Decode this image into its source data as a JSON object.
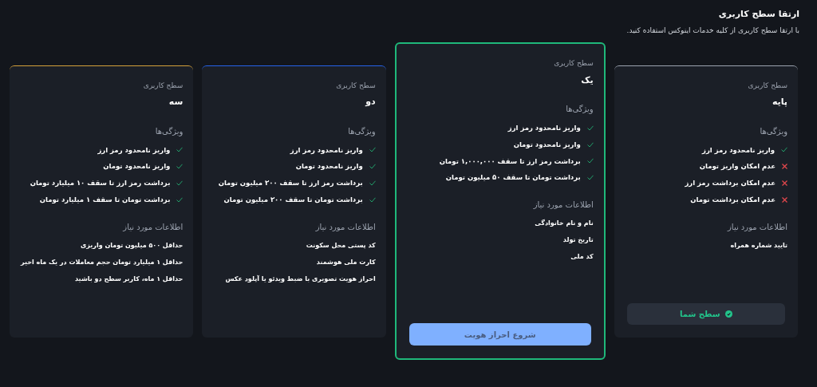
{
  "header": {
    "title": "ارتقا سطح کاربری",
    "subtitle": "با ارتقا سطح کاربری از کلیه خدمات اینوکس استفاده کنید."
  },
  "levels": [
    {
      "caption": "سطح کاربری",
      "name": "پایه",
      "selected": false,
      "color": "#9ca3af",
      "features_title": "ویژگی‌ها",
      "features": [
        {
          "text": "واریز نامحدود رمز ارز",
          "available": true
        },
        {
          "text": "عدم امکان واریز تومان",
          "available": false
        },
        {
          "text": "عدم امکان برداشت رمز ارز",
          "available": false
        },
        {
          "text": "عدم امکان برداشت تومان",
          "available": false
        }
      ],
      "requirements_title": "اطلاعات مورد نیاز",
      "requirements": [
        "تایید شماره همراه"
      ],
      "footer": {
        "kind": "current",
        "label": "سطح شما"
      }
    },
    {
      "caption": "سطح کاربری",
      "name": "یک",
      "selected": true,
      "color": "#1fb87a",
      "features_title": "ویژگی‌ها",
      "features": [
        {
          "text": "واریز نامحدود رمز ارز",
          "available": true
        },
        {
          "text": "واریز نامحدود تومان",
          "available": true
        },
        {
          "text": "برداشت رمز ارز تا سقف ۱,۰۰۰,۰۰۰ تومان",
          "available": true
        },
        {
          "text": "برداشت تومان تا سقف ۵۰ میلیون تومان",
          "available": true
        }
      ],
      "requirements_title": "اطلاعات مورد نیاز",
      "requirements": [
        "نام و نام خانوادگی",
        "تاریخ تولد",
        "کد ملی"
      ],
      "footer": {
        "kind": "button",
        "label": "شروع احراز هویت"
      }
    },
    {
      "caption": "سطح کاربری",
      "name": "دو",
      "selected": false,
      "color": "#2563eb",
      "features_title": "ویژگی‌ها",
      "features": [
        {
          "text": "واریز نامحدود رمز ارز",
          "available": true
        },
        {
          "text": "واریز نامحدود تومان",
          "available": true
        },
        {
          "text": "برداشت رمز ارز تا سقف ۳۰۰ میلیون تومان",
          "available": true
        },
        {
          "text": "برداشت تومان تا سقف ۳۰۰ میلیون تومان",
          "available": true
        }
      ],
      "requirements_title": "اطلاعات مورد نیاز",
      "requirements": [
        "کد پستی محل سکونت",
        "کارت ملی هوشمند",
        "احراز هویت تصویری با ضبط ویدئو یا آپلود عکس"
      ]
    },
    {
      "caption": "سطح کاربری",
      "name": "سه",
      "selected": false,
      "color": "#d4a03a",
      "features_title": "ویژگی‌ها",
      "features": [
        {
          "text": "واریز نامحدود رمز ارز",
          "available": true
        },
        {
          "text": "واریز نامحدود تومان",
          "available": true
        },
        {
          "text": "برداشت رمز ارز تا سقف ۱۰ میلیارد تومان",
          "available": true
        },
        {
          "text": "برداشت تومان تا سقف ۱ میلیارد تومان",
          "available": true
        }
      ],
      "requirements_title": "اطلاعات مورد نیاز",
      "requirements": [
        "حداقل ۵۰۰ میلیون تومان واریزی",
        "حداقل ۱ میلیارد تومان حجم معاملات در یک ماه اخیر",
        "حداقل ۱ ماه، کاربر سطح دو باشید"
      ]
    }
  ]
}
